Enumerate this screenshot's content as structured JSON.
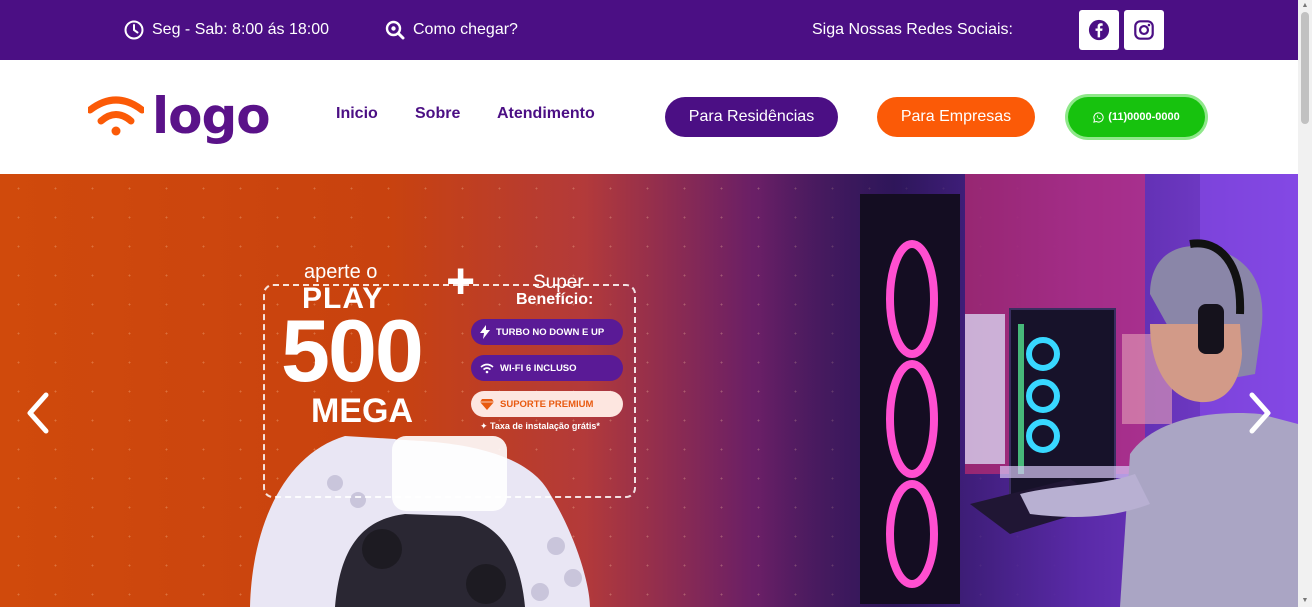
{
  "topbar": {
    "hours": "Seg - Sab: 8:00 ás 18:00",
    "directions": "Como chegar?",
    "social_label": "Siga Nossas Redes Sociais:",
    "social_icons": [
      "facebook-icon",
      "instagram-icon"
    ]
  },
  "header": {
    "logo_text": "logo",
    "nav": [
      "Inicio",
      "Sobre",
      "Atendimento"
    ],
    "btn_residencias": "Para Residências",
    "btn_empresas": "Para Empresas",
    "btn_whatsapp": "(11)0000-0000"
  },
  "hero": {
    "aperte": "aperte o",
    "play": "PLAY",
    "speed": "500",
    "unit": "MEGA",
    "plus": "+",
    "super": "Super",
    "beneficio": "Benefício:",
    "features": [
      "TURBO NO DOWN E UP",
      "WI-FI 6 INCLUSO",
      "SUPORTE PREMIUM"
    ],
    "taxa": "✦ Taxa de instalação grátis*"
  },
  "colors": {
    "brand_purple": "#4b0f84",
    "brand_orange": "#fb5a07",
    "whatsapp_green": "#17c20e"
  }
}
